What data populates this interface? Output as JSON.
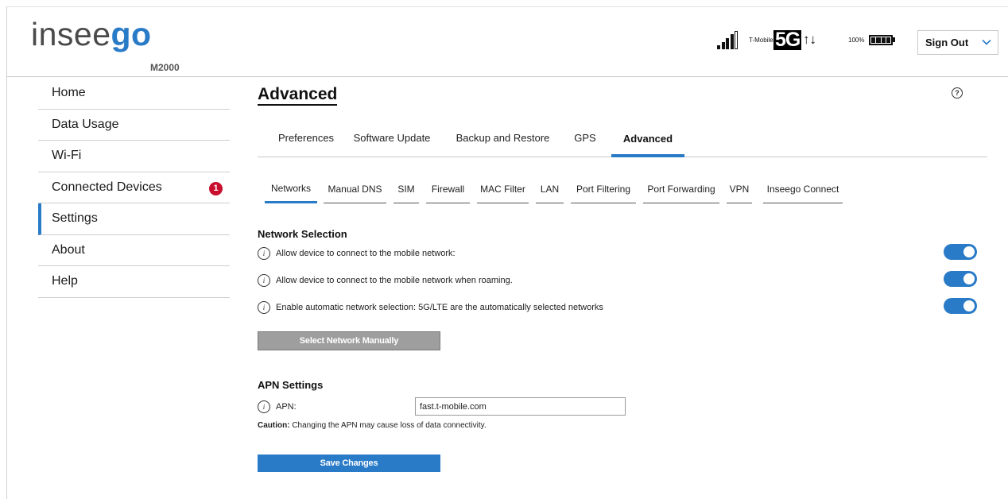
{
  "header": {
    "logo_text_1": "insee",
    "logo_text_2": "go",
    "model": "M2000",
    "carrier": "T-Mobile",
    "network_type": "5G",
    "data_arrows": "↑↓",
    "battery_percent": "100%",
    "signal_bars": 4,
    "signout_label": "Sign Out"
  },
  "sidebar": {
    "items": [
      {
        "label": "Home"
      },
      {
        "label": "Data Usage"
      },
      {
        "label": "Wi-Fi"
      },
      {
        "label": "Connected Devices",
        "badge": "1"
      },
      {
        "label": "Settings",
        "active": true
      },
      {
        "label": "About"
      },
      {
        "label": "Help"
      }
    ]
  },
  "main": {
    "title": "Advanced",
    "help_glyph": "?",
    "tabs": [
      "Preferences",
      "Software Update",
      "Backup and Restore",
      "GPS",
      "Advanced"
    ],
    "active_tab": "Advanced",
    "subtabs": [
      "Networks",
      "Manual DNS",
      "SIM",
      "Firewall",
      "MAC Filter",
      "LAN",
      "Port Filtering",
      "Port Forwarding",
      "VPN",
      "Inseego Connect"
    ],
    "active_subtab": "Networks",
    "network_selection": {
      "title": "Network Selection",
      "rows": [
        {
          "label": "Allow device to connect to the mobile network:",
          "enabled": true
        },
        {
          "label": "Allow device to connect to the mobile network when roaming.",
          "enabled": true
        },
        {
          "label": "Enable automatic network selection: 5G/LTE are the automatically selected networks",
          "enabled": true
        }
      ],
      "manual_button": "Select Network Manually"
    },
    "apn": {
      "title": "APN Settings",
      "label": "APN:",
      "value": "fast.t-mobile.com",
      "caution_bold": "Caution:",
      "caution_text": " Changing the APN may cause loss of data connectivity.",
      "save_button": "Save Changes"
    }
  },
  "colors": {
    "accent": "#2a7bc7",
    "badge": "#c8102e",
    "disabled_button": "#9e9e9e"
  }
}
